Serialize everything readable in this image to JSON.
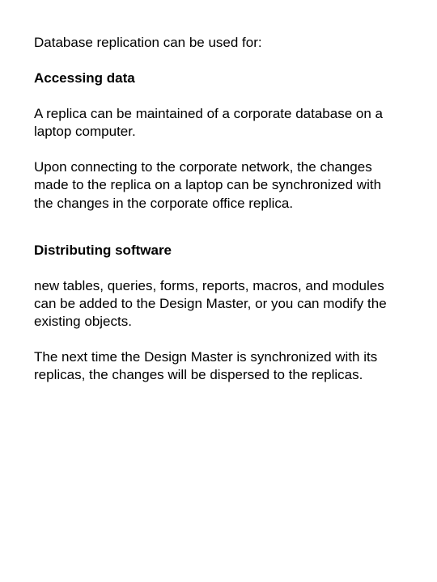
{
  "intro": "Database replication can be used for:",
  "sections": [
    {
      "heading": "Accessing data",
      "paragraphs": [
        "A replica can be maintained of a corporate database on a laptop computer.",
        "Upon connecting to the corporate network, the changes made to the replica on a laptop can be synchronized with the changes in the corporate office replica."
      ]
    },
    {
      "heading": "Distributing software",
      "paragraphs": [
        "new tables, queries, forms, reports, macros, and modules can be added to the Design Master, or you can modify the existing objects.",
        "The next time the Design Master is synchronized with its replicas, the changes will be dispersed to the replicas."
      ]
    }
  ]
}
